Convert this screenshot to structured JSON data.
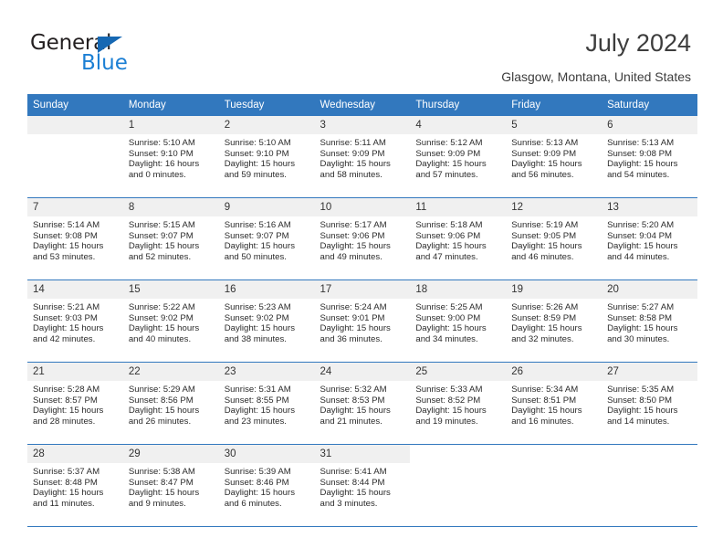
{
  "brand": {
    "name_dark": "General",
    "name_blue": "Blue",
    "triangle_color": "#1668b3",
    "blue_color": "#1b7fd4"
  },
  "header": {
    "title": "July 2024",
    "subtitle": "Glasgow, Montana, United States"
  },
  "theme": {
    "header_row_bg": "#3278be",
    "day_number_bg": "#f0f0f0",
    "row_divider": "#3278be",
    "text": "#2b2b2b"
  },
  "weekday_headers": [
    "Sunday",
    "Monday",
    "Tuesday",
    "Wednesday",
    "Thursday",
    "Friday",
    "Saturday"
  ],
  "weeks": [
    [
      {
        "day": "",
        "blank": true,
        "sunrise": "",
        "sunset": "",
        "daylight1": "",
        "daylight2": ""
      },
      {
        "day": "1",
        "sunrise": "Sunrise: 5:10 AM",
        "sunset": "Sunset: 9:10 PM",
        "daylight1": "Daylight: 16 hours",
        "daylight2": "and 0 minutes."
      },
      {
        "day": "2",
        "sunrise": "Sunrise: 5:10 AM",
        "sunset": "Sunset: 9:10 PM",
        "daylight1": "Daylight: 15 hours",
        "daylight2": "and 59 minutes."
      },
      {
        "day": "3",
        "sunrise": "Sunrise: 5:11 AM",
        "sunset": "Sunset: 9:09 PM",
        "daylight1": "Daylight: 15 hours",
        "daylight2": "and 58 minutes."
      },
      {
        "day": "4",
        "sunrise": "Sunrise: 5:12 AM",
        "sunset": "Sunset: 9:09 PM",
        "daylight1": "Daylight: 15 hours",
        "daylight2": "and 57 minutes."
      },
      {
        "day": "5",
        "sunrise": "Sunrise: 5:13 AM",
        "sunset": "Sunset: 9:09 PM",
        "daylight1": "Daylight: 15 hours",
        "daylight2": "and 56 minutes."
      },
      {
        "day": "6",
        "sunrise": "Sunrise: 5:13 AM",
        "sunset": "Sunset: 9:08 PM",
        "daylight1": "Daylight: 15 hours",
        "daylight2": "and 54 minutes."
      }
    ],
    [
      {
        "day": "7",
        "sunrise": "Sunrise: 5:14 AM",
        "sunset": "Sunset: 9:08 PM",
        "daylight1": "Daylight: 15 hours",
        "daylight2": "and 53 minutes."
      },
      {
        "day": "8",
        "sunrise": "Sunrise: 5:15 AM",
        "sunset": "Sunset: 9:07 PM",
        "daylight1": "Daylight: 15 hours",
        "daylight2": "and 52 minutes."
      },
      {
        "day": "9",
        "sunrise": "Sunrise: 5:16 AM",
        "sunset": "Sunset: 9:07 PM",
        "daylight1": "Daylight: 15 hours",
        "daylight2": "and 50 minutes."
      },
      {
        "day": "10",
        "sunrise": "Sunrise: 5:17 AM",
        "sunset": "Sunset: 9:06 PM",
        "daylight1": "Daylight: 15 hours",
        "daylight2": "and 49 minutes."
      },
      {
        "day": "11",
        "sunrise": "Sunrise: 5:18 AM",
        "sunset": "Sunset: 9:06 PM",
        "daylight1": "Daylight: 15 hours",
        "daylight2": "and 47 minutes."
      },
      {
        "day": "12",
        "sunrise": "Sunrise: 5:19 AM",
        "sunset": "Sunset: 9:05 PM",
        "daylight1": "Daylight: 15 hours",
        "daylight2": "and 46 minutes."
      },
      {
        "day": "13",
        "sunrise": "Sunrise: 5:20 AM",
        "sunset": "Sunset: 9:04 PM",
        "daylight1": "Daylight: 15 hours",
        "daylight2": "and 44 minutes."
      }
    ],
    [
      {
        "day": "14",
        "sunrise": "Sunrise: 5:21 AM",
        "sunset": "Sunset: 9:03 PM",
        "daylight1": "Daylight: 15 hours",
        "daylight2": "and 42 minutes."
      },
      {
        "day": "15",
        "sunrise": "Sunrise: 5:22 AM",
        "sunset": "Sunset: 9:02 PM",
        "daylight1": "Daylight: 15 hours",
        "daylight2": "and 40 minutes."
      },
      {
        "day": "16",
        "sunrise": "Sunrise: 5:23 AM",
        "sunset": "Sunset: 9:02 PM",
        "daylight1": "Daylight: 15 hours",
        "daylight2": "and 38 minutes."
      },
      {
        "day": "17",
        "sunrise": "Sunrise: 5:24 AM",
        "sunset": "Sunset: 9:01 PM",
        "daylight1": "Daylight: 15 hours",
        "daylight2": "and 36 minutes."
      },
      {
        "day": "18",
        "sunrise": "Sunrise: 5:25 AM",
        "sunset": "Sunset: 9:00 PM",
        "daylight1": "Daylight: 15 hours",
        "daylight2": "and 34 minutes."
      },
      {
        "day": "19",
        "sunrise": "Sunrise: 5:26 AM",
        "sunset": "Sunset: 8:59 PM",
        "daylight1": "Daylight: 15 hours",
        "daylight2": "and 32 minutes."
      },
      {
        "day": "20",
        "sunrise": "Sunrise: 5:27 AM",
        "sunset": "Sunset: 8:58 PM",
        "daylight1": "Daylight: 15 hours",
        "daylight2": "and 30 minutes."
      }
    ],
    [
      {
        "day": "21",
        "sunrise": "Sunrise: 5:28 AM",
        "sunset": "Sunset: 8:57 PM",
        "daylight1": "Daylight: 15 hours",
        "daylight2": "and 28 minutes."
      },
      {
        "day": "22",
        "sunrise": "Sunrise: 5:29 AM",
        "sunset": "Sunset: 8:56 PM",
        "daylight1": "Daylight: 15 hours",
        "daylight2": "and 26 minutes."
      },
      {
        "day": "23",
        "sunrise": "Sunrise: 5:31 AM",
        "sunset": "Sunset: 8:55 PM",
        "daylight1": "Daylight: 15 hours",
        "daylight2": "and 23 minutes."
      },
      {
        "day": "24",
        "sunrise": "Sunrise: 5:32 AM",
        "sunset": "Sunset: 8:53 PM",
        "daylight1": "Daylight: 15 hours",
        "daylight2": "and 21 minutes."
      },
      {
        "day": "25",
        "sunrise": "Sunrise: 5:33 AM",
        "sunset": "Sunset: 8:52 PM",
        "daylight1": "Daylight: 15 hours",
        "daylight2": "and 19 minutes."
      },
      {
        "day": "26",
        "sunrise": "Sunrise: 5:34 AM",
        "sunset": "Sunset: 8:51 PM",
        "daylight1": "Daylight: 15 hours",
        "daylight2": "and 16 minutes."
      },
      {
        "day": "27",
        "sunrise": "Sunrise: 5:35 AM",
        "sunset": "Sunset: 8:50 PM",
        "daylight1": "Daylight: 15 hours",
        "daylight2": "and 14 minutes."
      }
    ],
    [
      {
        "day": "28",
        "sunrise": "Sunrise: 5:37 AM",
        "sunset": "Sunset: 8:48 PM",
        "daylight1": "Daylight: 15 hours",
        "daylight2": "and 11 minutes."
      },
      {
        "day": "29",
        "sunrise": "Sunrise: 5:38 AM",
        "sunset": "Sunset: 8:47 PM",
        "daylight1": "Daylight: 15 hours",
        "daylight2": "and 9 minutes."
      },
      {
        "day": "30",
        "sunrise": "Sunrise: 5:39 AM",
        "sunset": "Sunset: 8:46 PM",
        "daylight1": "Daylight: 15 hours",
        "daylight2": "and 6 minutes."
      },
      {
        "day": "31",
        "sunrise": "Sunrise: 5:41 AM",
        "sunset": "Sunset: 8:44 PM",
        "daylight1": "Daylight: 15 hours",
        "daylight2": "and 3 minutes."
      },
      {
        "day": "",
        "blank": true,
        "sunrise": "",
        "sunset": "",
        "daylight1": "",
        "daylight2": ""
      },
      {
        "day": "",
        "blank": true,
        "sunrise": "",
        "sunset": "",
        "daylight1": "",
        "daylight2": ""
      },
      {
        "day": "",
        "blank": true,
        "sunrise": "",
        "sunset": "",
        "daylight1": "",
        "daylight2": ""
      }
    ]
  ]
}
